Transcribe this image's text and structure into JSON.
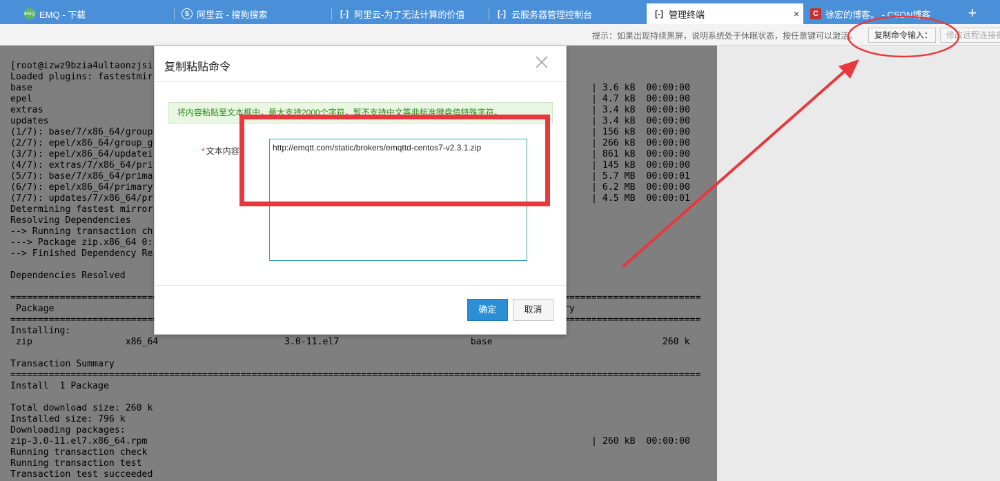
{
  "tabs": [
    {
      "label": "EMQ - 下载",
      "icon": "emq-logo-icon",
      "active": false
    },
    {
      "label": "阿里云 - 搜狗搜索",
      "icon": "sogou-icon",
      "active": false
    },
    {
      "label": "阿里云-为了无法计算的价值",
      "icon": "aliyun-icon",
      "active": false
    },
    {
      "label": "云服务器管理控制台",
      "icon": "aliyun-icon",
      "active": false
    },
    {
      "label": "管理终端",
      "icon": "aliyun-icon",
      "active": true
    },
    {
      "label": "徐宏的博客。 - CSDN博客",
      "icon": "csdn-icon",
      "active": false
    }
  ],
  "tab_close": "×",
  "new_tab": "+",
  "toolbar": {
    "hint": "提示：如果出现持续黑屏，说明系统处于休眠状态，按任意键可以激活。",
    "copy_command_label": "复制命令输入：",
    "modify_password_label": "修改远程连接密码"
  },
  "terminal": {
    "lines": [
      {
        "text": "[root@izwz9bzia4ultaonzjsi",
        "right": ""
      },
      {
        "text": "Loaded plugins: fastestmir",
        "right": ""
      },
      {
        "text": "base",
        "right": "| 3.6 kB  00:00:00"
      },
      {
        "text": "epel",
        "right": "| 4.7 kB  00:00:00"
      },
      {
        "text": "extras",
        "right": "| 3.4 kB  00:00:00"
      },
      {
        "text": "updates",
        "right": "| 3.4 kB  00:00:00"
      },
      {
        "text": "(1/7): base/7/x86_64/group",
        "right": "| 156 kB  00:00:00"
      },
      {
        "text": "(2/7): epel/x86_64/group_g",
        "right": "| 266 kB  00:00:00"
      },
      {
        "text": "(3/7): epel/x86_64/updatei",
        "right": "| 861 kB  00:00:00"
      },
      {
        "text": "(4/7): extras/7/x86_64/pri",
        "right": "| 145 kB  00:00:00"
      },
      {
        "text": "(5/7): base/7/x86_64/prima",
        "right": "| 5.7 MB  00:00:01"
      },
      {
        "text": "(6/7): epel/x86_64/primary",
        "right": "| 6.2 MB  00:00:00"
      },
      {
        "text": "(7/7): updates/7/x86_64/pr",
        "right": "| 4.5 MB  00:00:01"
      },
      {
        "text": "Determining fastest mirror",
        "right": ""
      },
      {
        "text": "Resolving Dependencies",
        "right": ""
      },
      {
        "text": "--> Running transaction ch",
        "right": ""
      },
      {
        "text": "---> Package zip.x86_64 0:",
        "right": ""
      },
      {
        "text": "--> Finished Dependency Re",
        "right": ""
      },
      {
        "text": "",
        "right": ""
      },
      {
        "text": "Dependencies Resolved",
        "right": ""
      },
      {
        "text": "",
        "right": ""
      },
      {
        "text": "==============================================================================================================================",
        "right": ""
      },
      {
        "text": " Package",
        "right": "",
        "tail": "ory                                        Size"
      },
      {
        "text": "==============================================================================================================================",
        "right": ""
      },
      {
        "text": "Installing:",
        "right": ""
      },
      {
        "text": " zip                 x86_64                       3.0-11.el7                        base                               260 k",
        "right": ""
      },
      {
        "text": "",
        "right": ""
      },
      {
        "text": "Transaction Summary",
        "right": ""
      },
      {
        "text": "==============================================================================================================================",
        "right": ""
      },
      {
        "text": "Install  1 Package",
        "right": ""
      },
      {
        "text": "",
        "right": ""
      },
      {
        "text": "Total download size: 260 k",
        "right": ""
      },
      {
        "text": "Installed size: 796 k",
        "right": ""
      },
      {
        "text": "Downloading packages:",
        "right": ""
      },
      {
        "text": "zip-3.0-11.el7.x86_64.rpm",
        "right": "| 260 kB  00:00:00"
      },
      {
        "text": "Running transaction check",
        "right": ""
      },
      {
        "text": "Running transaction test",
        "right": ""
      },
      {
        "text": "Transaction test succeeded",
        "right": ""
      }
    ]
  },
  "modal": {
    "title": "复制粘贴命令",
    "notice": "将内容粘贴至文本框中，最大支持2000个字符，暂不支持中文等非标准键盘值特殊字符。",
    "field_required_mark": "*",
    "field_label": "文本内容",
    "text_value": "http://emqtt.com/static/brokers/emqttd-centos7-v2.3.1.zip",
    "ok_label": "确定",
    "cancel_label": "取消"
  },
  "colors": {
    "tabbar": "#4a90d9",
    "annotation": "#e8383d",
    "ok_button": "#2b8fd6"
  }
}
